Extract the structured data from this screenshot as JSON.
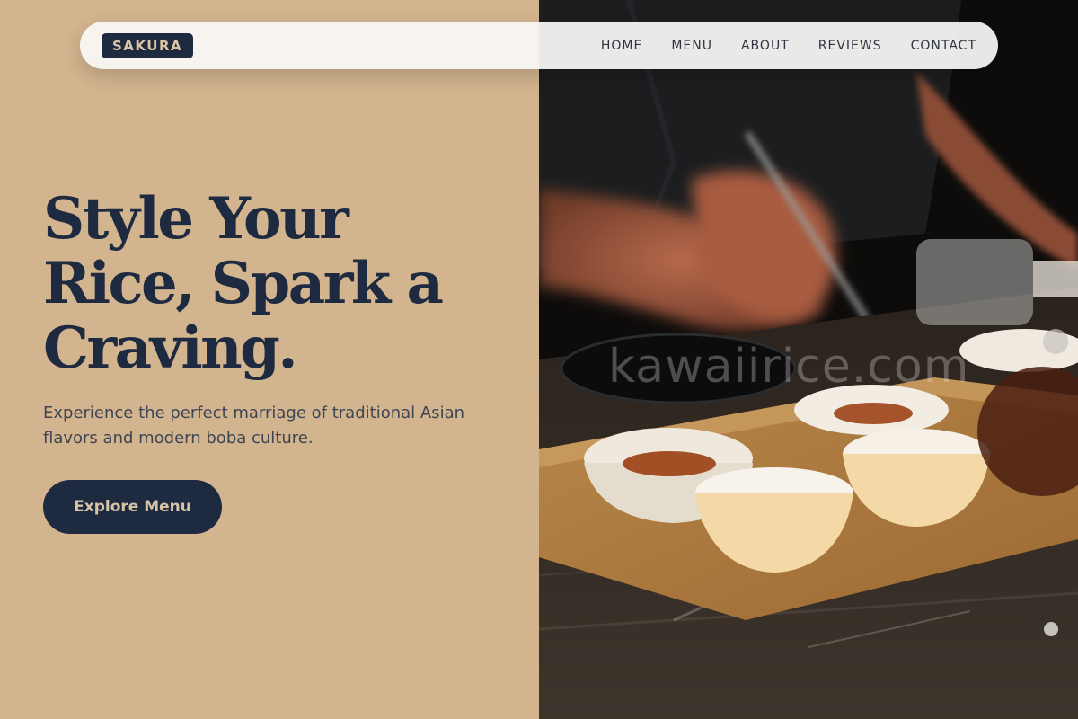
{
  "brand": {
    "logo_text": "SAKURA"
  },
  "nav": {
    "items": [
      {
        "label": "HOME"
      },
      {
        "label": "MENU"
      },
      {
        "label": "ABOUT"
      },
      {
        "label": "REVIEWS"
      },
      {
        "label": "CONTACT"
      }
    ]
  },
  "hero": {
    "title_lines": [
      "Style Your",
      "Rice, Spark a",
      "Craving."
    ],
    "subtitle": "Experience the perfect marriage of traditional Asian flavors and modern boba culture.",
    "cta_label": "Explore Menu",
    "image_watermark": "kawaiirice.com"
  },
  "colors": {
    "beige_background": "#d2b48e",
    "navy_accent": "#1e2a40",
    "cta_text": "#d7c3a6"
  }
}
